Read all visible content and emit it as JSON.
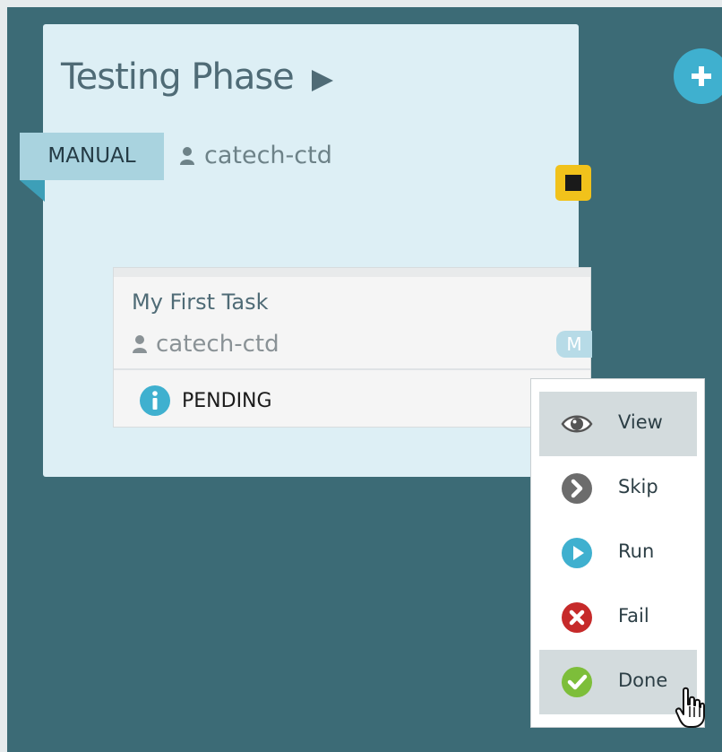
{
  "phase": {
    "title": "Testing Phase",
    "mode_tag": "MANUAL",
    "owner": "catech-ctd"
  },
  "task": {
    "title": "My First Task",
    "owner": "catech-ctd",
    "badge": "M",
    "status": "PENDING"
  },
  "menu": {
    "items": [
      {
        "label": "View",
        "icon": "eye-icon"
      },
      {
        "label": "Skip",
        "icon": "skip-icon"
      },
      {
        "label": "Run",
        "icon": "run-icon"
      },
      {
        "label": "Fail",
        "icon": "fail-icon"
      },
      {
        "label": "Done",
        "icon": "done-icon"
      }
    ]
  },
  "colors": {
    "background": "#3c6b76",
    "card": "#ddeff5",
    "accent_yellow": "#f1c21b",
    "accent_blue": "#3fb0cf",
    "fail_red": "#c62a2a",
    "done_green": "#7dbe3a"
  }
}
